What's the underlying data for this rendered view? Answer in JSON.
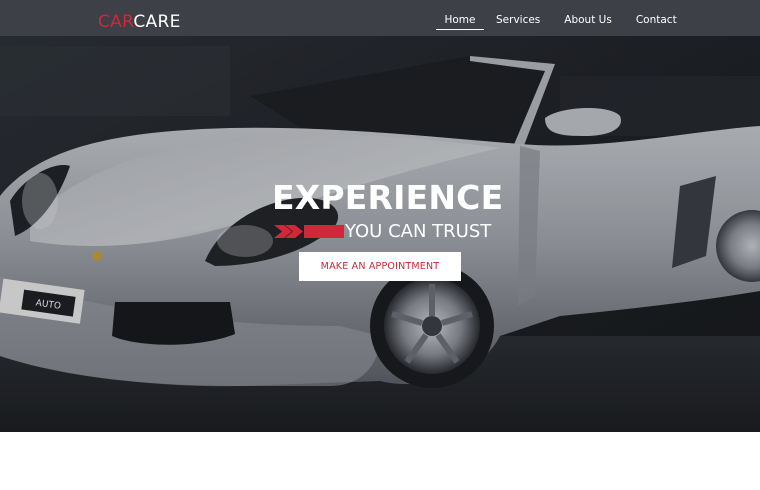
{
  "brand": {
    "part1": "CAR",
    "part2": "CARE",
    "accent_color": "#d0283a"
  },
  "nav": {
    "items": [
      {
        "label": "Home",
        "active": true
      },
      {
        "label": "Services",
        "active": false
      },
      {
        "label": "About Us",
        "active": false
      },
      {
        "label": "Contact",
        "active": false
      }
    ]
  },
  "hero": {
    "headline": "EXPERIENCE",
    "subline": "YOU CAN TRUST",
    "cta_label": "MAKE AN APPOINTMENT",
    "plate_text": "AUTO"
  }
}
